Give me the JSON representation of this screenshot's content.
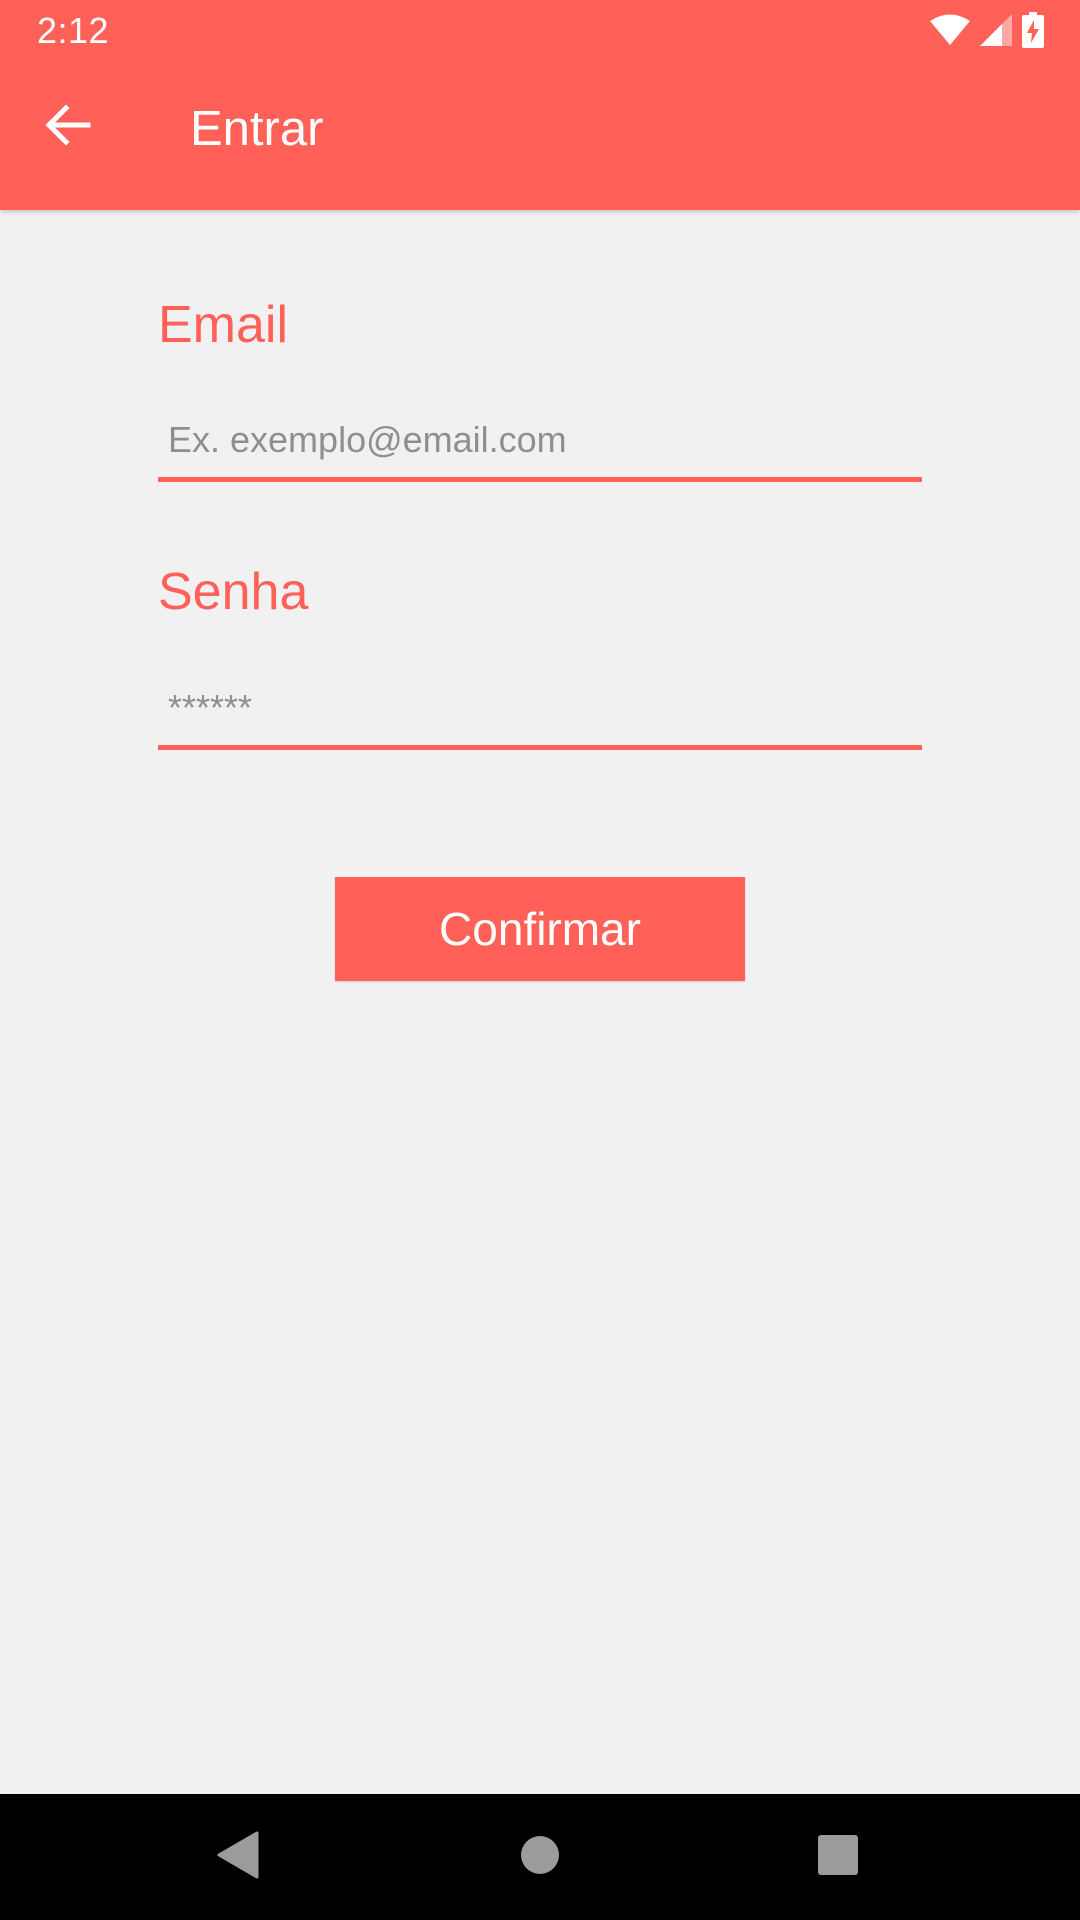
{
  "status_bar": {
    "time": "2:12",
    "icons": [
      "wifi-icon",
      "signal-icon",
      "battery-charging-icon"
    ]
  },
  "app_bar": {
    "title": "Entrar",
    "back_icon": "arrow-back-icon"
  },
  "form": {
    "email": {
      "label": "Email",
      "value": "",
      "placeholder": "Ex. exemplo@email.com"
    },
    "password": {
      "label": "Senha",
      "value": "",
      "placeholder": "******"
    },
    "confirm_label": "Confirmar"
  },
  "nav_bar": {
    "icons": [
      "nav-back-icon",
      "nav-home-icon",
      "nav-recents-icon"
    ]
  },
  "colors": {
    "accent": "#ff6057",
    "background": "#f2f1f1",
    "nav_background": "#000000",
    "placeholder": "#8f8f8f"
  }
}
